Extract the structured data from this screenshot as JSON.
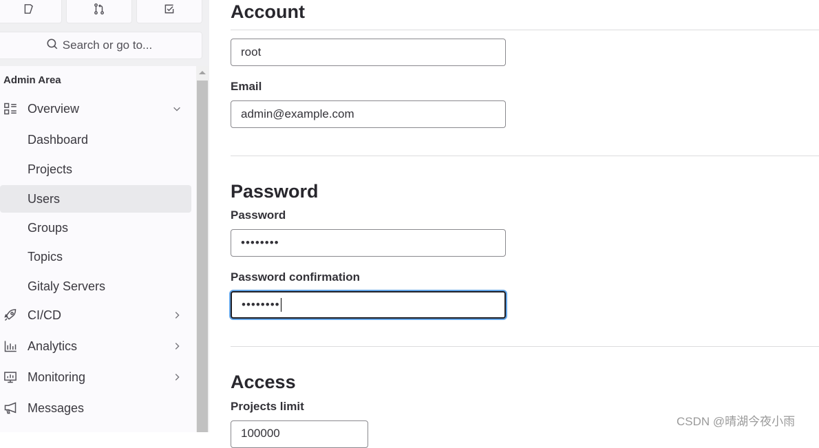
{
  "sidebar": {
    "top_buttons": [
      {
        "icon": "issues-icon",
        "label": "Issues"
      },
      {
        "icon": "merge-request-icon",
        "label": "Merge requests"
      },
      {
        "icon": "todo-icon",
        "label": "To-Do List"
      }
    ],
    "search": {
      "placeholder": "Search or go to..."
    },
    "section_title": "Admin Area",
    "items": [
      {
        "label": "Overview",
        "icon": "overview-icon",
        "chevron": "down",
        "active": false
      },
      {
        "label": "Dashboard",
        "sub": true,
        "active": false
      },
      {
        "label": "Projects",
        "sub": true,
        "active": false
      },
      {
        "label": "Users",
        "sub": true,
        "active": true
      },
      {
        "label": "Groups",
        "sub": true,
        "active": false
      },
      {
        "label": "Topics",
        "sub": true,
        "active": false
      },
      {
        "label": "Gitaly Servers",
        "sub": true,
        "active": false
      },
      {
        "label": "CI/CD",
        "icon": "rocket-icon",
        "chevron": "right",
        "active": false
      },
      {
        "label": "Analytics",
        "icon": "analytics-icon",
        "chevron": "right",
        "active": false
      },
      {
        "label": "Monitoring",
        "icon": "monitor-icon",
        "chevron": "right",
        "active": false
      },
      {
        "label": "Messages",
        "icon": "megaphone-icon",
        "active": false
      }
    ]
  },
  "main": {
    "account": {
      "heading": "Account",
      "username_value": "root",
      "email_label": "Email",
      "email_value": "admin@example.com"
    },
    "password": {
      "heading": "Password",
      "password_label": "Password",
      "password_value": "••••••••",
      "confirmation_label": "Password confirmation",
      "confirmation_value": "••••••••"
    },
    "access": {
      "heading": "Access",
      "projects_limit_label": "Projects limit",
      "projects_limit_value": "100000"
    }
  },
  "watermark": "CSDN @晴湖今夜小雨",
  "colors": {
    "focus_ring": "#63a6e9",
    "active_item_bg": "#e9e9ec",
    "sidebar_bg": "#fbfafd"
  }
}
